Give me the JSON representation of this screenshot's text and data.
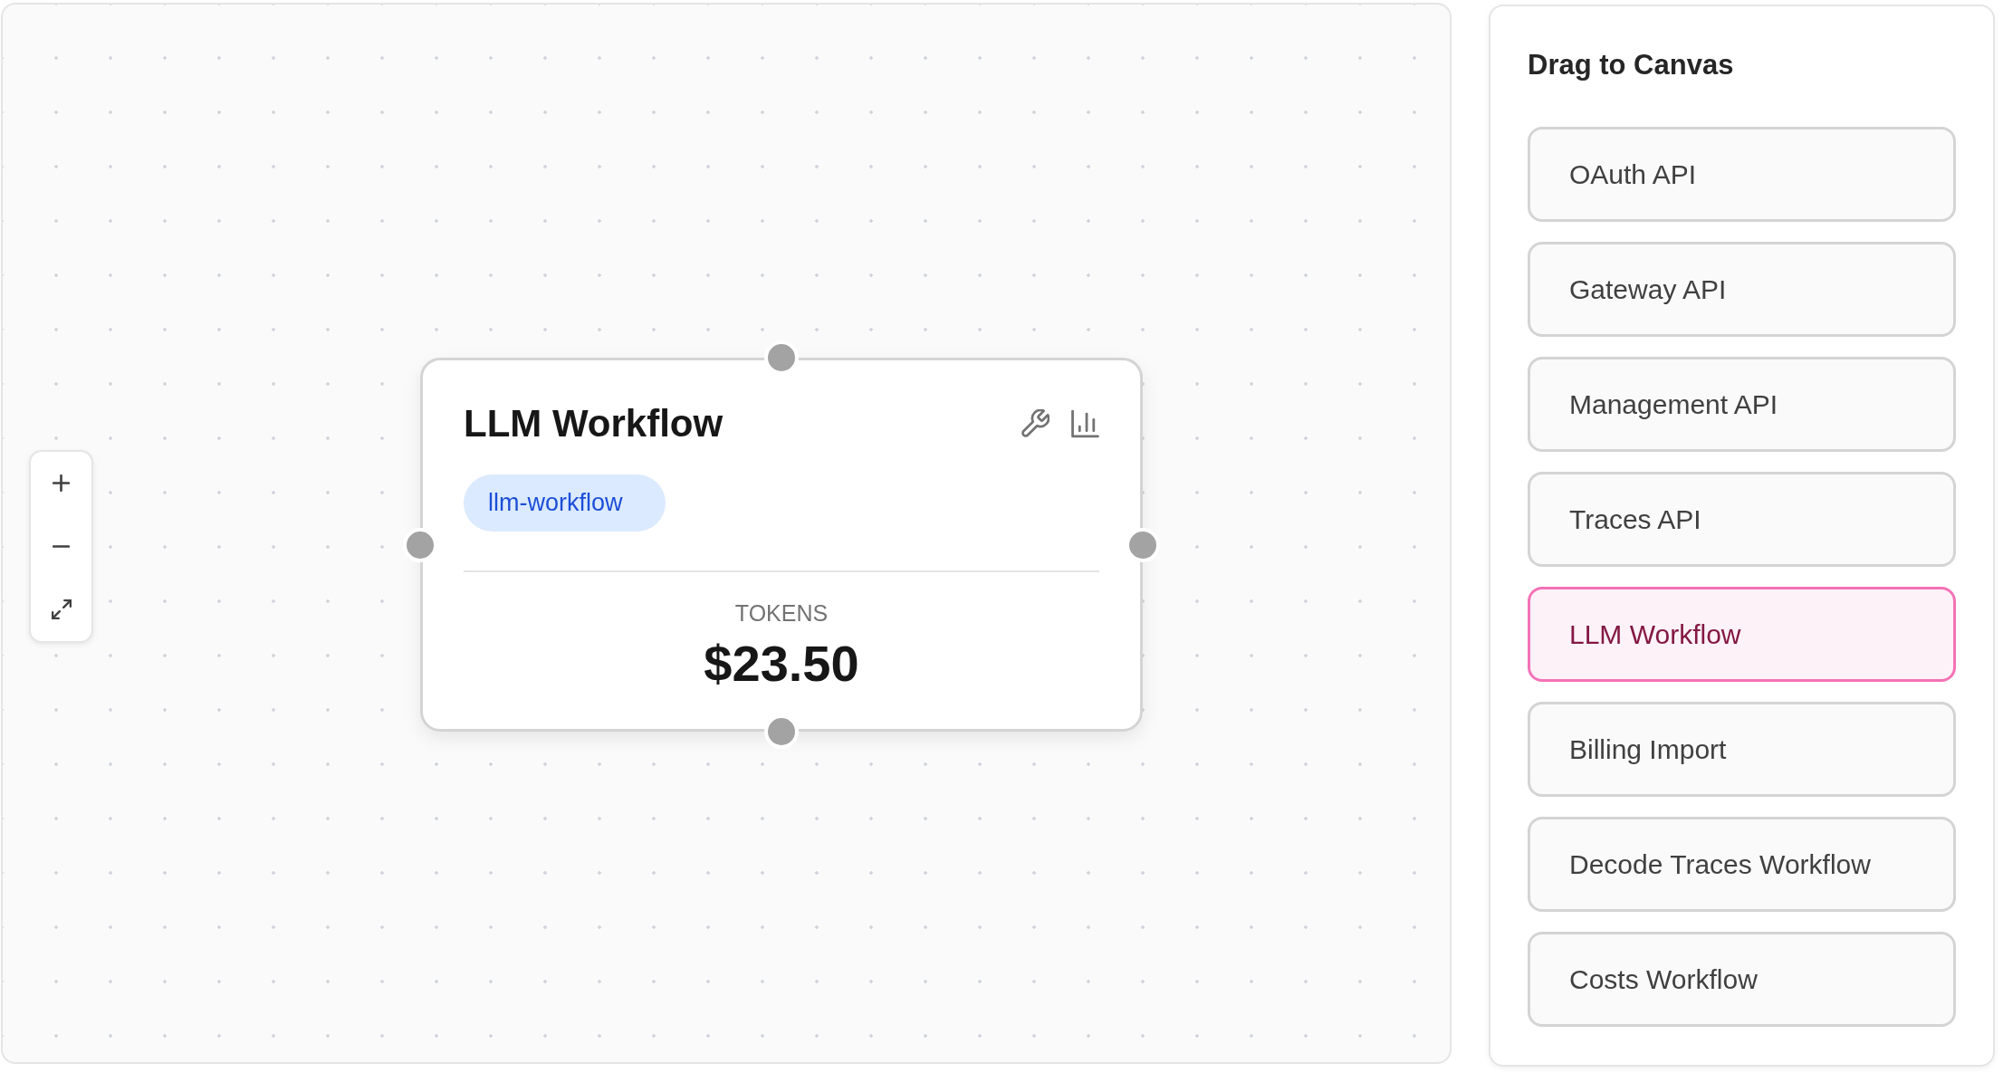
{
  "canvas": {
    "node": {
      "title": "LLM Workflow",
      "tag": "llm-workflow",
      "metric_label": "TOKENS",
      "metric_value": "$23.50"
    }
  },
  "palette": {
    "title": "Drag to Canvas",
    "items": [
      {
        "label": "OAuth API",
        "selected": false
      },
      {
        "label": "Gateway API",
        "selected": false
      },
      {
        "label": "Management API",
        "selected": false
      },
      {
        "label": "Traces API",
        "selected": false
      },
      {
        "label": "LLM Workflow",
        "selected": true
      },
      {
        "label": "Billing Import",
        "selected": false
      },
      {
        "label": "Decode Traces Workflow",
        "selected": false
      },
      {
        "label": "Costs Workflow",
        "selected": false
      }
    ]
  }
}
